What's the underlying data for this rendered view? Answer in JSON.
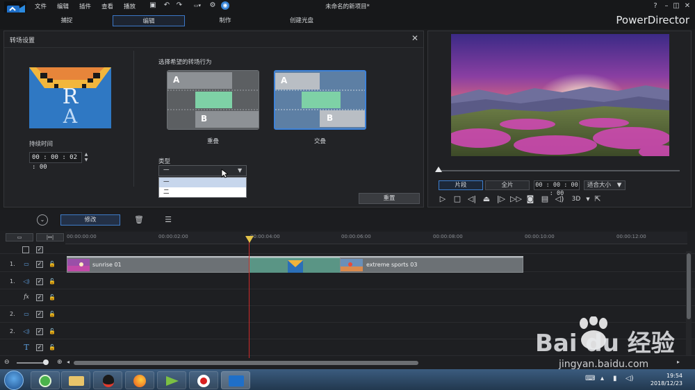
{
  "menubar": {
    "items": [
      "文件",
      "编辑",
      "插件",
      "查看",
      "播放"
    ],
    "title": "未命名的新项目*"
  },
  "modes": {
    "tabs": [
      "捕捉",
      "编辑",
      "制作",
      "创建光盘"
    ],
    "brand": "PowerDirector"
  },
  "transition_panel": {
    "title": "转场设置",
    "duration_label": "持续时间",
    "duration_value": "00 : 00 : 02 : 00",
    "choose_label": "选择希望的转场行为",
    "option_overlap": "重叠",
    "option_cross": "交叠",
    "option_a": "A",
    "option_b": "B",
    "type_label": "类型",
    "type_selected": "一",
    "type_options": [
      "一",
      "二"
    ],
    "reset_label": "重置"
  },
  "preview": {
    "clip_tab": "片段",
    "full_tab": "全片",
    "timecode": "00 : 00 : 00 : 00",
    "fit_label": "适合大小",
    "three_d": "3D"
  },
  "edit_toolbar": {
    "modify_label": "修改"
  },
  "timeline": {
    "ticks": [
      "00:00:00:00",
      "00:00:02:00",
      "00:00:04:00",
      "00:00:06:00",
      "00:00:08:00",
      "00:00:10:00",
      "00:00:12:00"
    ],
    "track_indices": [
      "1.",
      "1.",
      "2.",
      "2."
    ],
    "clip_a_label": "sunrise 01",
    "clip_b_label": "extreme sports 03"
  },
  "taskbar": {
    "time": "19:54",
    "date": "2018/12/23"
  },
  "watermark": {
    "text": "Bai du 经验",
    "url": "jingyan.baidu.com"
  },
  "colors": {
    "accent": "#3c7fd0",
    "playhead": "#d12a2a",
    "transition": "#5a9585"
  }
}
